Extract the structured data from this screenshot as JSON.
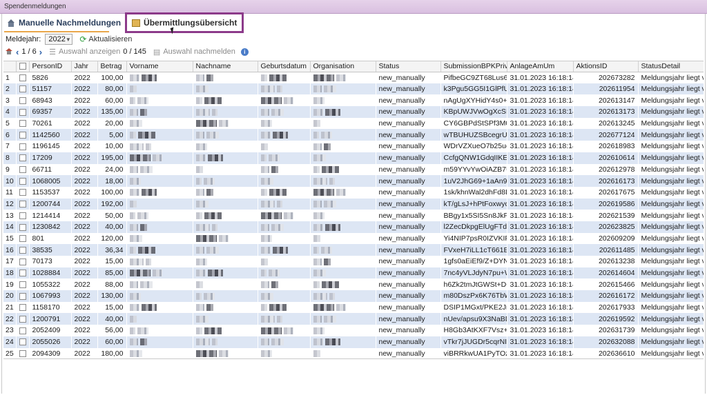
{
  "window": {
    "title": "Spendenmeldungen"
  },
  "tabs": [
    {
      "label": "Manuelle Nachmeldungen"
    },
    {
      "label": "Übermittlungsübersicht"
    }
  ],
  "toolbar": {
    "year_label": "Meldejahr:",
    "year_value": "2022",
    "refresh_label": "Aktualisieren",
    "page_label": "1 / 6",
    "show_selection_label": "Auswahl anzeigen",
    "selection_count": "0 / 145",
    "report_selection_label": "Auswahl nachmelden"
  },
  "grid": {
    "columns": [
      "",
      "",
      "PersonID",
      "Jahr",
      "Betrag",
      "Vorname",
      "Nachname",
      "Geburtsdatum",
      "Organisation",
      "Status",
      "SubmissionBPKPrivate",
      "AnlageAmUm",
      "AktionsID",
      "StatusDetail"
    ],
    "rows": [
      [
        "1",
        "5826",
        "2022",
        "100,00",
        "new_manually",
        "PifbeGC9ZT68Lus6jL03",
        "31.01.2023 16:18:14",
        "202673282",
        "Meldungsjahr liegt vor"
      ],
      [
        "2",
        "51157",
        "2022",
        "80,00",
        "new_manually",
        "k3Pgu5GG5I1GlPfUAbl",
        "31.01.2023 16:18:14",
        "202611954",
        "Meldungsjahr liegt vor"
      ],
      [
        "3",
        "68943",
        "2022",
        "60,00",
        "new_manually",
        "nAgUgXYHidY4s0+Bt4",
        "31.01.2023 16:18:14",
        "202613147",
        "Meldungsjahr liegt vor"
      ],
      [
        "4",
        "69357",
        "2022",
        "135,00",
        "new_manually",
        "KBpUWJVwOgXcSBv12",
        "31.01.2023 16:18:14",
        "202613173",
        "Meldungsjahr liegt vor"
      ],
      [
        "5",
        "70261",
        "2022",
        "20,00",
        "new_manually",
        "CY6GBPdStSPf3M0ptur",
        "31.01.2023 16:18:14",
        "202613245",
        "Meldungsjahr liegt vor"
      ],
      [
        "6",
        "1142560",
        "2022",
        "5,00",
        "new_manually",
        "wTBUHUZSBcegrUibEM",
        "31.01.2023 16:18:14",
        "202677124",
        "Meldungsjahr liegt vor"
      ],
      [
        "7",
        "1196145",
        "2022",
        "10,00",
        "new_manually",
        "WDrVZXueO7b25uca7",
        "31.01.2023 16:18:14",
        "202618983",
        "Meldungsjahr liegt vor"
      ],
      [
        "8",
        "17209",
        "2022",
        "195,00",
        "new_manually",
        "CcfgQNW1GdqIIKEHQ",
        "31.01.2023 16:18:14",
        "202610614",
        "Meldungsjahr liegt vor"
      ],
      [
        "9",
        "66711",
        "2022",
        "24,00",
        "new_manually",
        "m59YYvYwOiAZB7Ud3",
        "31.01.2023 16:18:14",
        "202612978",
        "Meldungsjahr liegt vor"
      ],
      [
        "10",
        "1068005",
        "2022",
        "18,00",
        "new_manually",
        "1uV2JhG69+1aAn9eNt",
        "31.01.2023 16:18:14",
        "202616173",
        "Meldungsjahr liegt vor"
      ],
      [
        "11",
        "1153537",
        "2022",
        "100,00",
        "new_manually",
        "1sk/khnWal2dhFd8LvA",
        "31.01.2023 16:18:14",
        "202617675",
        "Meldungsjahr liegt vor"
      ],
      [
        "12",
        "1200744",
        "2022",
        "192,00",
        "new_manually",
        "kT/gLsJ+hPtFoxwydL1",
        "31.01.2023 16:18:14",
        "202619586",
        "Meldungsjahr liegt vor"
      ],
      [
        "13",
        "1214414",
        "2022",
        "50,00",
        "new_manually",
        "BBgy1x5SI5Sn8JkPJDV",
        "31.01.2023 16:18:14",
        "202621539",
        "Meldungsjahr liegt vor"
      ],
      [
        "14",
        "1230842",
        "2022",
        "40,00",
        "new_manually",
        "l2ZecDkpgElUgFTdyB0",
        "31.01.2023 16:18:14",
        "202623825",
        "Meldungsjahr liegt vor"
      ],
      [
        "15",
        "801",
        "2022",
        "120,00",
        "new_manually",
        "Yi4NIP7psR0IZVKIPgM",
        "31.01.2023 16:18:14",
        "202609209",
        "Meldungsjahr liegt vor"
      ],
      [
        "16",
        "38535",
        "2022",
        "36,34",
        "new_manually",
        "FVxeH7iLL1cT661E8XC",
        "31.01.2023 16:18:14",
        "202611485",
        "Meldungsjahr liegt vor"
      ],
      [
        "17",
        "70173",
        "2022",
        "15,00",
        "new_manually",
        "1gfs0aEiEf9/Z+DYNQy",
        "31.01.2023 16:18:14",
        "202613238",
        "Meldungsjahr liegt vor"
      ],
      [
        "18",
        "1028884",
        "2022",
        "85,00",
        "new_manually",
        "7nc4yVLJdyN7pu+Wg7",
        "31.01.2023 16:18:14",
        "202614604",
        "Meldungsjahr liegt vor"
      ],
      [
        "19",
        "1055322",
        "2022",
        "88,00",
        "new_manually",
        "h6Zk2tmJtGWSt+D6AF",
        "31.01.2023 16:18:14",
        "202615466",
        "Meldungsjahr liegt vor"
      ],
      [
        "20",
        "1067993",
        "2022",
        "130,00",
        "new_manually",
        "m80DszPx6K76TbWh8",
        "31.01.2023 16:18:14",
        "202616172",
        "Meldungsjahr liegt vor"
      ],
      [
        "21",
        "1158170",
        "2022",
        "15,00",
        "new_manually",
        "DSIP1MGxt/PKE2JrapE",
        "31.01.2023 16:18:14",
        "202617933",
        "Meldungsjahr liegt vor"
      ],
      [
        "22",
        "1200791",
        "2022",
        "40,00",
        "new_manually",
        "nUev/apsu9X3NaBDqc",
        "31.01.2023 16:18:14",
        "202619592",
        "Meldungsjahr liegt vor"
      ],
      [
        "23",
        "2052409",
        "2022",
        "56,00",
        "new_manually",
        "H8Gb3AtKXF7Vsz+Gh7",
        "31.01.2023 16:18:14",
        "202631739",
        "Meldungsjahr liegt vor"
      ],
      [
        "24",
        "2055026",
        "2022",
        "60,00",
        "new_manually",
        "vTkr7jJUGDr5cqrNIUfm",
        "31.01.2023 16:18:14",
        "202632088",
        "Meldungsjahr liegt vor"
      ],
      [
        "25",
        "2094309",
        "2022",
        "180,00",
        "new_manually",
        "viBRRkwUA1PyTOzPyE",
        "31.01.2023 16:18:14",
        "202636610",
        "Meldungsjahr liegt vor"
      ]
    ]
  },
  "colors": {
    "highlight_outline": "#8c3a8a",
    "alt_row": "#dde6f4",
    "titlebar": "#d9bfe0"
  }
}
